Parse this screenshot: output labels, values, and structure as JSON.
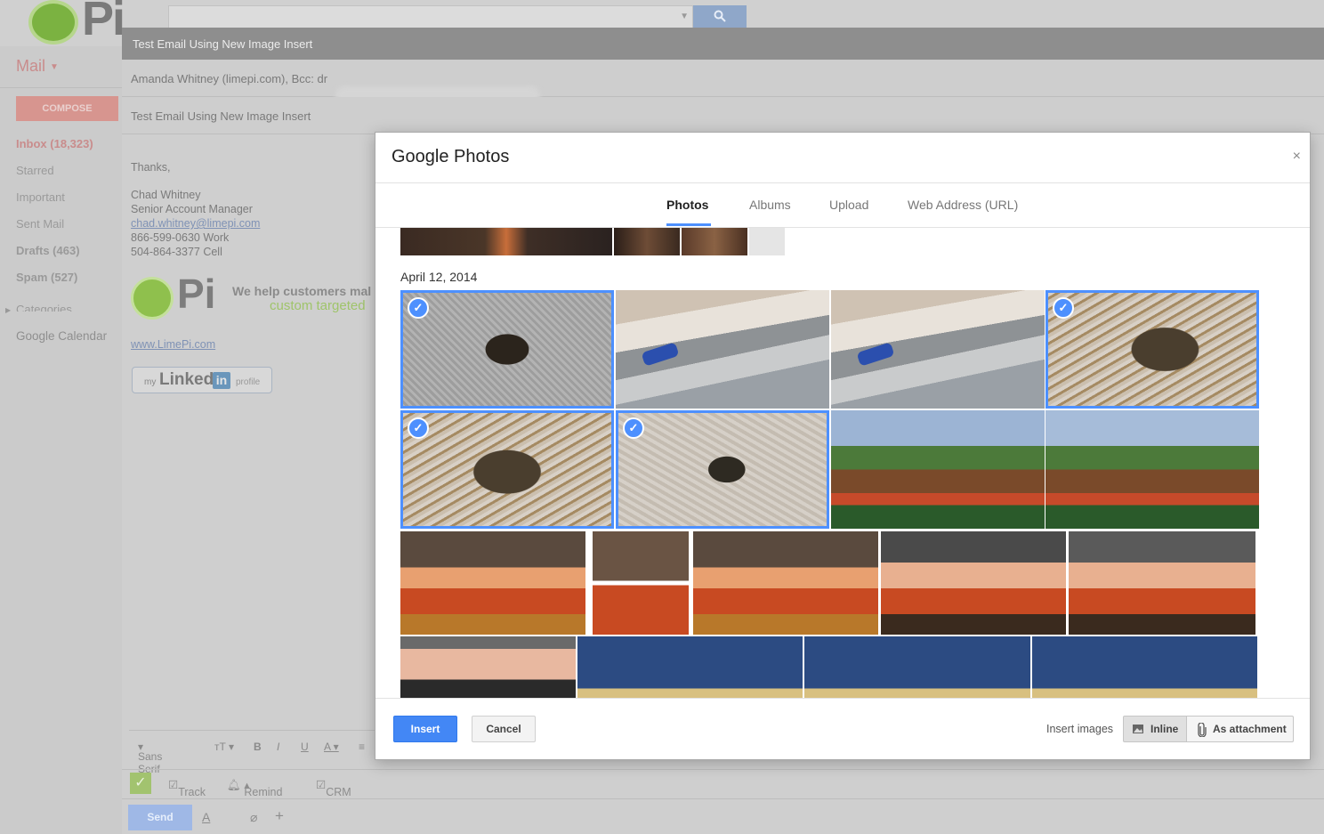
{
  "gmail": {
    "mail_label": "Mail",
    "compose_label": "COMPOSE",
    "nav": [
      {
        "label": "Inbox (18,323)"
      },
      {
        "label": "Starred"
      },
      {
        "label": "Important"
      },
      {
        "label": "Sent Mail"
      },
      {
        "label": "Drafts (463)"
      },
      {
        "label": "Spam (527)"
      },
      {
        "label": "Categories"
      },
      {
        "label": "Google Calendar"
      }
    ]
  },
  "compose": {
    "window_title": "Test Email Using New Image Insert",
    "recipients": "Amanda Whitney (limepi.com), Bcc: dr",
    "subject": "Test Email Using New Image Insert",
    "signature": {
      "thanks": "Thanks,",
      "name": "Chad Whitney",
      "title": "Senior Account Manager",
      "email": "chad.whitney@limepi.com",
      "work": "866-599-0630 Work",
      "cell": "504-864-3377 Cell",
      "tagline1": "We help customers mal",
      "tagline2": "custom targeted",
      "website": "www.LimePi.com",
      "linkedin_my": "my",
      "linkedin_word": "Linked",
      "linkedin_in": "in",
      "linkedin_profile": "profile",
      "logo_text": "Pi"
    },
    "format_bar": {
      "font": "Sans Serif"
    },
    "ext_bar": {
      "track": "Track",
      "remind": "Remind",
      "crm": "CRM"
    },
    "send_label": "Send"
  },
  "dialog": {
    "title": "Google Photos",
    "close": "×",
    "tabs": [
      {
        "label": "Photos",
        "active": true
      },
      {
        "label": "Albums"
      },
      {
        "label": "Upload"
      },
      {
        "label": "Web Address (URL)"
      }
    ],
    "date_label": "April 12, 2014",
    "selected_count": 4,
    "insert_label": "Insert",
    "cancel_label": "Cancel",
    "insert_images_label": "Insert images",
    "inline_label": "Inline",
    "attachment_label": "As attachment"
  },
  "colors": {
    "accent": "#4d90fe",
    "insert_button": "#4387f5"
  }
}
